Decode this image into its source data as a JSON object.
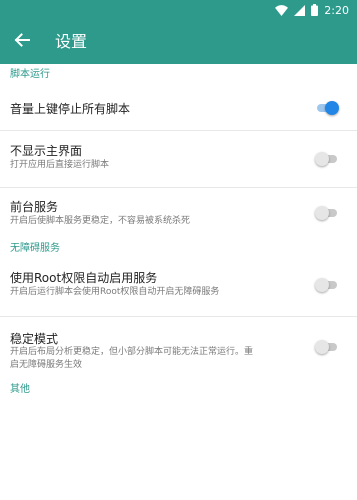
{
  "status_bar": {
    "time": "2:20",
    "icons": [
      "wifi-icon",
      "signal-icon",
      "battery-icon"
    ]
  },
  "app_bar": {
    "title": "设置",
    "back_icon": "arrow-left-icon"
  },
  "sections": [
    {
      "header": "脚本运行",
      "items": [
        {
          "title": "音量上键停止所有脚本",
          "subtitle": "",
          "enabled": true
        },
        {
          "title": "不显示主界面",
          "subtitle": "打开应用后直接运行脚本",
          "enabled": false
        },
        {
          "title": "前台服务",
          "subtitle": "开启后使脚本服务更稳定，不容易被系统杀死",
          "enabled": false
        }
      ]
    },
    {
      "header": "无障碍服务",
      "items": [
        {
          "title": "使用Root权限自动启用服务",
          "subtitle": "开启后运行脚本会使用Root权限自动开启无障碍服务",
          "enabled": false
        },
        {
          "title": "稳定模式",
          "subtitle": "开启后布局分析更稳定，但小部分脚本可能无法正常运行。重",
          "subtitle2": "启无障碍服务生效",
          "enabled": false
        }
      ]
    },
    {
      "header": "其他",
      "items": []
    }
  ],
  "colors": {
    "primary": "#2d9a8c",
    "accent": "#2186e6",
    "toggle_off": "#e6e6e6"
  }
}
